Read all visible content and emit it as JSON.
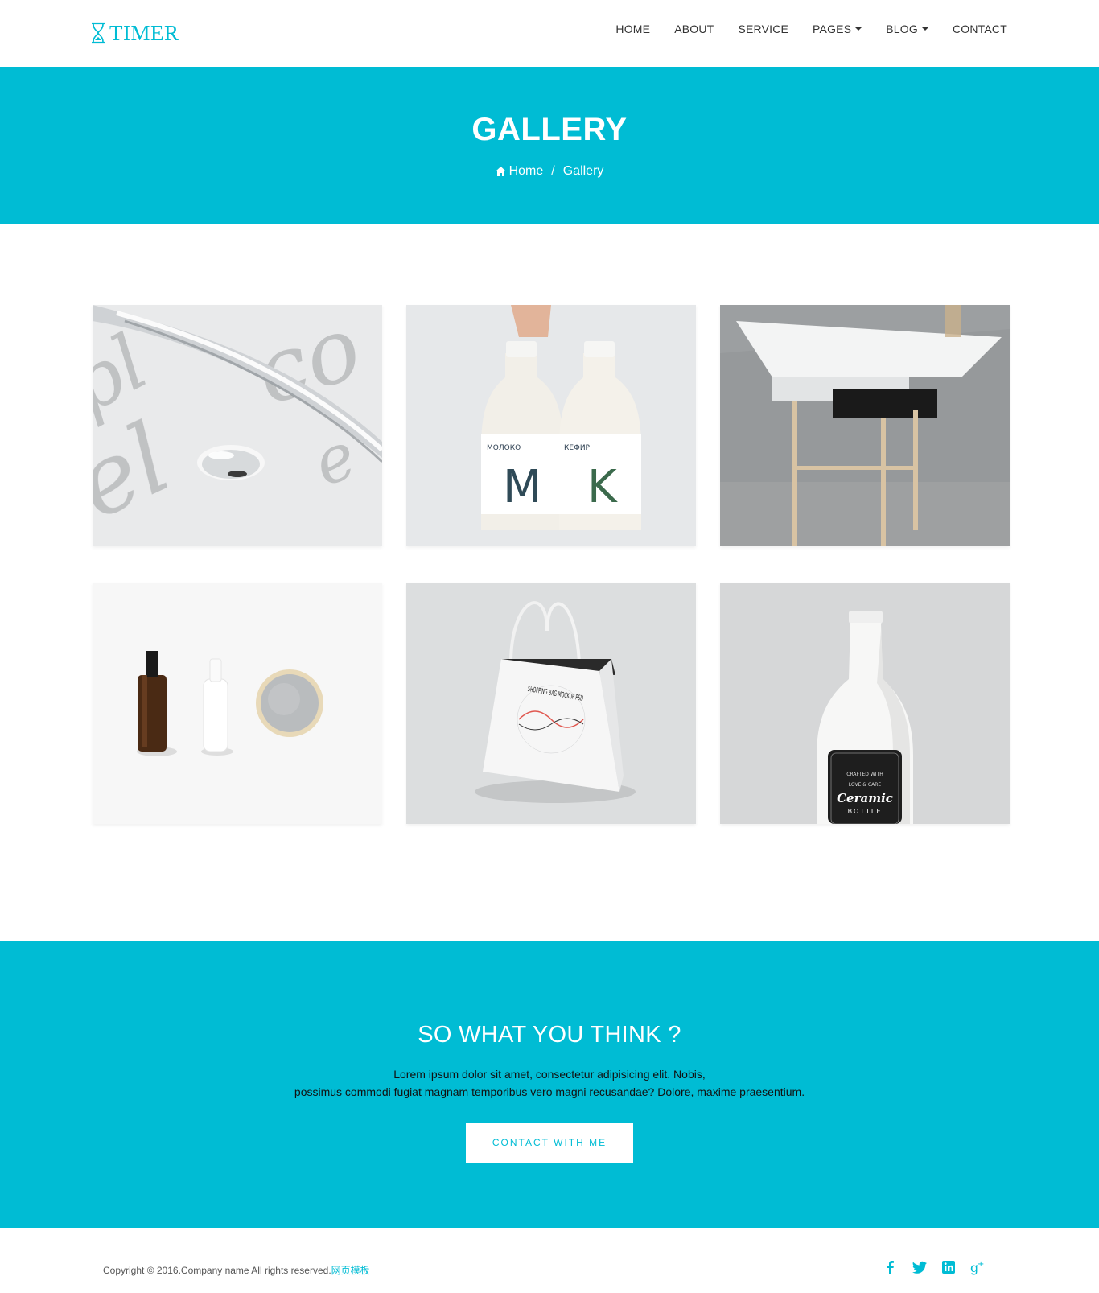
{
  "header": {
    "logo_text": "TIMER",
    "nav": [
      {
        "label": "HOME"
      },
      {
        "label": "ABOUT"
      },
      {
        "label": "SERVICE"
      },
      {
        "label": "PAGES",
        "dropdown": true
      },
      {
        "label": "BLOG",
        "dropdown": true
      },
      {
        "label": "CONTACT"
      }
    ]
  },
  "banner": {
    "title": "GALLERY",
    "breadcrumb": {
      "home": "Home",
      "separator": "/",
      "current": "Gallery"
    }
  },
  "gallery": {
    "items": [
      {
        "icon": "typography-waterdrop-image"
      },
      {
        "icon": "milk-bottles-image",
        "labels": [
          "МОЛОКО",
          "КЕФИР"
        ]
      },
      {
        "icon": "white-desk-image"
      },
      {
        "icon": "cosmetics-image"
      },
      {
        "icon": "shopping-bag-image",
        "bag_text": "SHOPPING BAG MOCKUP PSD"
      },
      {
        "icon": "ceramic-bottle-image",
        "label_lines": [
          "CRAFTED WITH",
          "LOVE & CARE",
          "Ceramic",
          "BOTTLE"
        ]
      }
    ]
  },
  "cta": {
    "title": "SO WHAT YOU THINK ?",
    "text_line1": "Lorem ipsum dolor sit amet, consectetur adipisicing elit.  Nobis,",
    "text_line2": "possimus commodi fugiat magnam temporibus vero magni recusandae? Dolore, maxime praesentium.",
    "button_label": "CONTACT WITH ME"
  },
  "footer": {
    "copyright": "Copyright © 2016.Company name All rights reserved.",
    "copyright_link": "网页模板",
    "social": [
      "facebook-icon",
      "twitter-icon",
      "linkedin-icon",
      "google-plus-icon"
    ]
  },
  "colors": {
    "accent": "#00bcd4",
    "text": "#333333",
    "white": "#ffffff"
  }
}
